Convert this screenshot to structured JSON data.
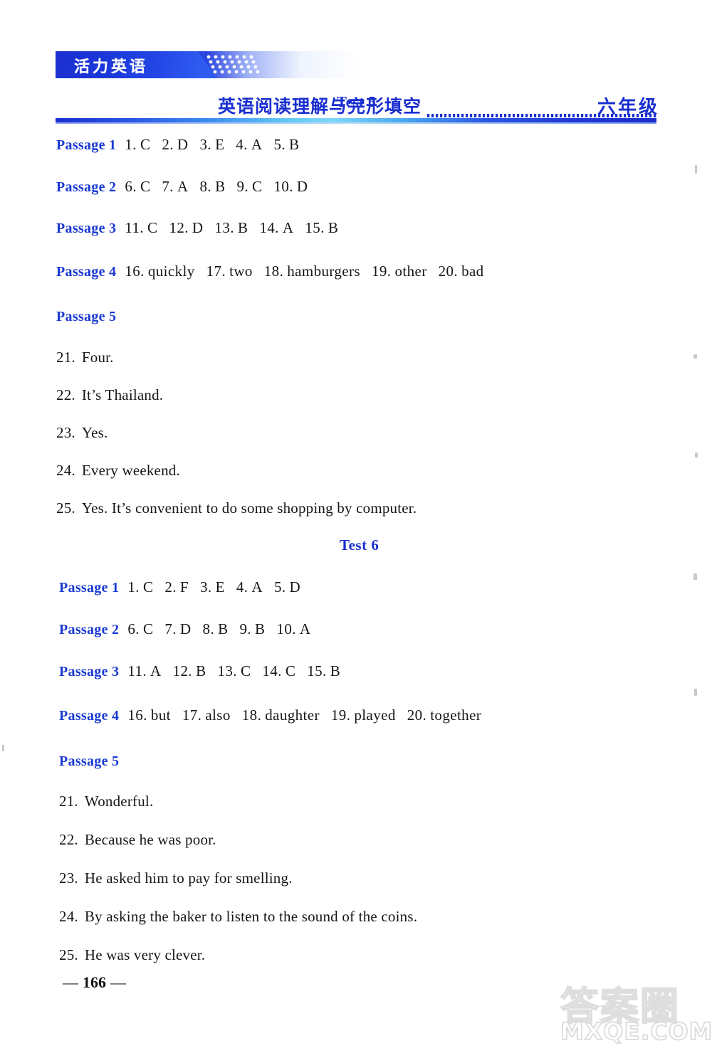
{
  "header": {
    "badge_text": "活力英语",
    "title": "英语阅读理解与完形填空",
    "grade": "六年级",
    "accent_color": "#1a2fcf",
    "badge_bg": "#1d2fd0"
  },
  "tests": [
    {
      "heading": "Test 5",
      "passages": [
        {
          "label": "Passage 1",
          "answers": [
            {
              "num": "1.",
              "val": "C"
            },
            {
              "num": "2.",
              "val": "D"
            },
            {
              "num": "3.",
              "val": "E"
            },
            {
              "num": "4.",
              "val": "A"
            },
            {
              "num": "5.",
              "val": "B"
            }
          ]
        },
        {
          "label": "Passage 2",
          "answers": [
            {
              "num": "6.",
              "val": "C"
            },
            {
              "num": "7.",
              "val": "A"
            },
            {
              "num": "8.",
              "val": "B"
            },
            {
              "num": "9.",
              "val": "C"
            },
            {
              "num": "10.",
              "val": "D"
            }
          ]
        },
        {
          "label": "Passage 3",
          "answers": [
            {
              "num": "11.",
              "val": "C"
            },
            {
              "num": "12.",
              "val": "D"
            },
            {
              "num": "13.",
              "val": "B"
            },
            {
              "num": "14.",
              "val": "A"
            },
            {
              "num": "15.",
              "val": "B"
            }
          ]
        },
        {
          "label": "Passage 4",
          "answers": [
            {
              "num": "16.",
              "val": "quickly"
            },
            {
              "num": "17.",
              "val": "two"
            },
            {
              "num": "18.",
              "val": "hamburgers"
            },
            {
              "num": "19.",
              "val": "other"
            },
            {
              "num": "20.",
              "val": "bad"
            }
          ]
        },
        {
          "label": "Passage 5",
          "answers": []
        }
      ],
      "qa": [
        {
          "num": "21.",
          "text": "Four."
        },
        {
          "num": "22.",
          "text": "It’s Thailand."
        },
        {
          "num": "23.",
          "text": "Yes."
        },
        {
          "num": "24.",
          "text": "Every weekend."
        },
        {
          "num": "25.",
          "text": "Yes.  It’s convenient to do some shopping by computer."
        }
      ]
    },
    {
      "heading": "Test 6",
      "passages": [
        {
          "label": "Passage 1",
          "answers": [
            {
              "num": "1.",
              "val": "C"
            },
            {
              "num": "2.",
              "val": "F"
            },
            {
              "num": "3.",
              "val": "E"
            },
            {
              "num": "4.",
              "val": "A"
            },
            {
              "num": "5.",
              "val": "D"
            }
          ]
        },
        {
          "label": "Passage 2",
          "answers": [
            {
              "num": "6.",
              "val": "C"
            },
            {
              "num": "7.",
              "val": "D"
            },
            {
              "num": "8.",
              "val": "B"
            },
            {
              "num": "9.",
              "val": "B"
            },
            {
              "num": "10.",
              "val": "A"
            }
          ]
        },
        {
          "label": "Passage 3",
          "answers": [
            {
              "num": "11.",
              "val": "A"
            },
            {
              "num": "12.",
              "val": "B"
            },
            {
              "num": "13.",
              "val": "C"
            },
            {
              "num": "14.",
              "val": "C"
            },
            {
              "num": "15.",
              "val": "B"
            }
          ]
        },
        {
          "label": "Passage 4",
          "answers": [
            {
              "num": "16.",
              "val": "but"
            },
            {
              "num": "17.",
              "val": "also"
            },
            {
              "num": "18.",
              "val": "daughter"
            },
            {
              "num": "19.",
              "val": "played"
            },
            {
              "num": "20.",
              "val": "together"
            }
          ]
        },
        {
          "label": "Passage 5",
          "answers": []
        }
      ],
      "qa": [
        {
          "num": "21.",
          "text": "Wonderful."
        },
        {
          "num": "22.",
          "text": "Because he was poor."
        },
        {
          "num": "23.",
          "text": "He asked him to pay for smelling."
        },
        {
          "num": "24.",
          "text": "By asking the baker to listen to the sound of the coins."
        },
        {
          "num": "25.",
          "text": "He was very clever."
        }
      ]
    }
  ],
  "footer": {
    "page_number": "166",
    "dash_left": "—",
    "dash_right": "—"
  },
  "watermark": {
    "chinese": "答案圈",
    "domain": "MXQE.COM"
  }
}
